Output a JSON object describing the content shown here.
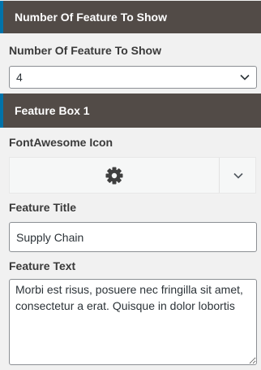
{
  "sections": {
    "number_header": "Number Of Feature To Show",
    "feature_box_header": "Feature Box 1"
  },
  "number_control": {
    "label": "Number Of Feature To Show",
    "selected_value": "4"
  },
  "icon_control": {
    "label": "FontAwesome Icon",
    "selected_icon": "gear-icon"
  },
  "title_control": {
    "label": "Feature Title",
    "value": "Supply Chain"
  },
  "text_control": {
    "label": "Feature Text",
    "value": "Morbi est risus, posuere nec fringilla sit amet, consectetur a erat. Quisque in dolor lobortis"
  },
  "colors": {
    "header_bg": "#524b47",
    "header_accent": "#0073aa",
    "panel_bg": "#f1f1f1"
  }
}
